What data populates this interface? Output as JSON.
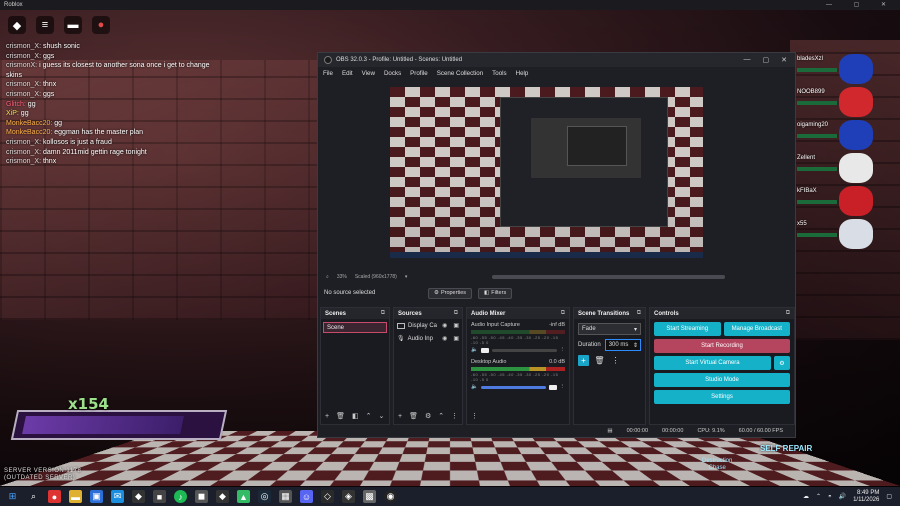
{
  "roblox": {
    "window_title": "Roblox",
    "window_controls": "—  ▢  ✕",
    "chat": [
      {
        "name": "crismon_X:",
        "text": "shush sonic"
      },
      {
        "name": "crismon_X:",
        "text": "ggs"
      },
      {
        "name": "crismonX:",
        "text": "i guess its closest to another sona once i get to change skins"
      },
      {
        "name": "crismon_X:",
        "text": "thnx"
      },
      {
        "name": "crismon_X:",
        "text": "ggs"
      },
      {
        "name": "Glitch:",
        "text": "gg"
      },
      {
        "name": "XiP:",
        "text": "gg"
      },
      {
        "name": "MonkeBacc20:",
        "text": "gg"
      },
      {
        "name": "MonkeBacc20:",
        "text": "eggman has the master plan"
      },
      {
        "name": "crismon_X:",
        "text": "kollosos is just a fraud"
      },
      {
        "name": "crismon_X:",
        "text": "damn 2011mid gettin rage tonight"
      },
      {
        "name": "crismon_X:",
        "text": "thnx"
      }
    ],
    "players": [
      {
        "name": "bladesXzl",
        "color": "#1e3fb8"
      },
      {
        "name": "NOOB899",
        "color": "#d0282c"
      },
      {
        "name": "oigaming20",
        "color": "#1e3fb8"
      },
      {
        "name": "Zellent",
        "color": "#e8e8e8"
      },
      {
        "name": "kFIBaX",
        "color": "#c92028"
      },
      {
        "name": "x55",
        "color": "#d8dde6"
      }
    ],
    "hud_value": "x154",
    "server_version": "SERVER VERSION:1178\n(OUTDATED SERVER)",
    "logo_text": "SELF REPAIR",
    "logo_text2": "Destruction\nChase"
  },
  "obs": {
    "title": "OBS 32.0.3 - Profile: Untitled - Scenes: Untitled",
    "window_controls": [
      "—",
      "▢",
      "✕"
    ],
    "menu": [
      "File",
      "Edit",
      "View",
      "Docks",
      "Profile",
      "Scene Collection",
      "Tools",
      "Help"
    ],
    "zoom": "33%",
    "canvas": "Scaled (960x1778)",
    "no_source": "No source selected",
    "properties_label": "Properties",
    "filters_label": "Filters",
    "docks": {
      "scenes": {
        "title": "Scenes",
        "items": [
          "Scene"
        ]
      },
      "sources": {
        "title": "Sources",
        "items": [
          "Display Ca",
          "Audio Inp"
        ]
      },
      "mixer": {
        "title": "Audio Mixer",
        "channels": [
          {
            "name": "Audio Input Capture",
            "db": "-inf dB",
            "scale": "-60 -55 -50 -45 -40 -35 -30 -25 -20 -15 -10 -5 0",
            "level": 0.0
          },
          {
            "name": "Desktop Audio",
            "db": "0.0 dB",
            "scale": "-60 -55 -50 -45 -40 -35 -30 -25 -20 -15 -10 -5 0",
            "level": 0.62
          }
        ]
      },
      "transitions": {
        "title": "Scene Transitions",
        "selected": "Fade",
        "duration_label": "Duration",
        "duration": "300 ms"
      },
      "controls": {
        "title": "Controls",
        "start_streaming": "Start Streaming",
        "manage_broadcast": "Manage Broadcast",
        "start_recording": "Start Recording",
        "start_virtual_camera": "Start Virtual Camera",
        "studio_mode": "Studio Mode",
        "settings": "Settings"
      }
    },
    "status": {
      "rec_time": "00:00:00",
      "stream_time": "00:00:00",
      "cpu": "CPU: 9.1%",
      "fps": "60.00 / 60.00 FPS"
    }
  },
  "taskbar": {
    "time": "8:49 PM",
    "date": "1/11/2026"
  },
  "colors": {
    "accent": "#14b1c8",
    "record": "#b5445e",
    "obs_bg": "#1e1f24"
  }
}
